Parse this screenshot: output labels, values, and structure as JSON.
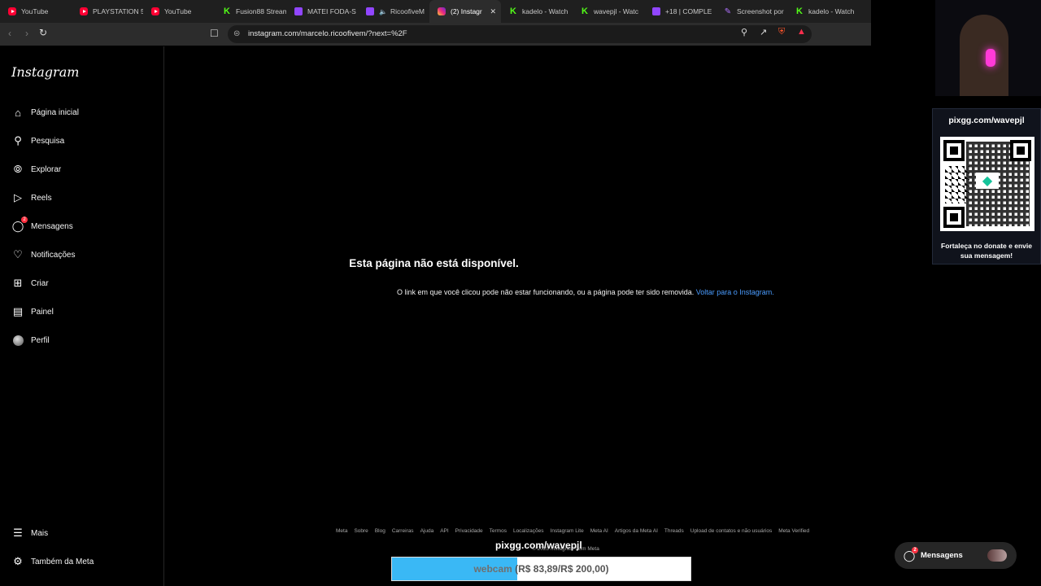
{
  "browser": {
    "tabs": [
      {
        "label": "YouTube",
        "icon": "youtube-icon"
      },
      {
        "label": "PLAYSTATION 5",
        "icon": "youtube-icon"
      },
      {
        "label": "YouTube",
        "icon": "youtube-icon"
      },
      {
        "label": "Fusion88 Stream",
        "icon": "kick-icon"
      },
      {
        "label": "MATEI FODA-S",
        "icon": "twitch-icon"
      },
      {
        "label": "RicoofiveM",
        "icon": "twitch-icon",
        "audio": true
      },
      {
        "label": "(2) Instagr",
        "icon": "instagram-icon",
        "active": true
      },
      {
        "label": "kadelo - Watch",
        "icon": "kick-icon"
      },
      {
        "label": "wavepjl - Watc",
        "icon": "kick-icon"
      },
      {
        "label": "+18 | COMPLE",
        "icon": "twitch-icon"
      },
      {
        "label": "Screenshot por",
        "icon": "pen-icon"
      },
      {
        "label": "kadelo - Watch",
        "icon": "kick-icon"
      }
    ],
    "url": "instagram.com/marcelo.ricoofivem/?next=%2F"
  },
  "sidebar": {
    "logo": "Instagram",
    "items": [
      {
        "label": "Página inicial",
        "icon": "home-icon"
      },
      {
        "label": "Pesquisa",
        "icon": "search-icon"
      },
      {
        "label": "Explorar",
        "icon": "compass-icon"
      },
      {
        "label": "Reels",
        "icon": "reels-icon"
      },
      {
        "label": "Mensagens",
        "icon": "messenger-icon",
        "badge": "2"
      },
      {
        "label": "Notificações",
        "icon": "heart-icon"
      },
      {
        "label": "Criar",
        "icon": "plus-icon"
      },
      {
        "label": "Painel",
        "icon": "dashboard-icon"
      },
      {
        "label": "Perfil",
        "icon": "avatar"
      }
    ],
    "more": "Mais",
    "meta": "Também da Meta"
  },
  "error": {
    "title": "Esta página não está disponível.",
    "text": "O link em que você clicou pode não estar funcionando, ou a página pode ter sido removida.",
    "link": "Voltar para o Instagram."
  },
  "footer": {
    "links": [
      "Meta",
      "Sobre",
      "Blog",
      "Carreiras",
      "Ajuda",
      "API",
      "Privacidade",
      "Termos",
      "Localizações",
      "Instagram Lite",
      "Meta AI",
      "Artigos da Meta AI",
      "Threads",
      "Upload de contatos e não usuários",
      "Meta Verified"
    ],
    "copyright": "© 2025 Instagram from Meta"
  },
  "overlay": {
    "pix_title": "pixgg.com/wavepjl",
    "pix_text": "Fortaleça no donate e envie sua mensagem!",
    "donate_url": "pixgg.com/wavepjl",
    "goal_label": "webcam",
    "goal_amount": "(R$ 83,89/R$ 200,00)",
    "goal_progress": 0.4195,
    "accent": "#3ab8f5"
  },
  "messages_pill": {
    "label": "Mensagens",
    "badge": "2"
  }
}
